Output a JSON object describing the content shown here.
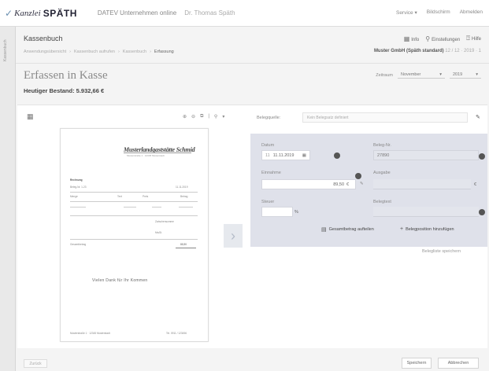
{
  "topbar": {
    "logo_k": "Kanzlei",
    "logo_s": "SPÄTH",
    "product": "DATEV Unternehmen online",
    "user": "Dr. Thomas Späth",
    "links": [
      "Service ▾",
      "Bildschirm",
      "Abmelden"
    ]
  },
  "leftstrip": {
    "tab": "Kassenbuch"
  },
  "page": {
    "title": "Kassenbuch",
    "breadcrumb": [
      "Anwendungsübersicht",
      "Kassenbuch aufrufen",
      "Kassenbuch",
      "Erfassung"
    ],
    "actions": {
      "info": "Info",
      "settings": "Einstellungen",
      "help": "Hilfe"
    },
    "company": "Muster GmbH (Späth standard)",
    "company_extra": "12 / 12 · 2019 · 1",
    "heading": "Erfassen in Kasse",
    "bestand": "Heutiger Bestand: 5.932,66 €",
    "zeitraum_label": "Zeitraum",
    "month": "November",
    "year": "2019"
  },
  "toolbar": {
    "belegquelle_label": "Belegquelle:",
    "belegquelle_placeholder": "Kein Belegsatz definiert"
  },
  "document": {
    "title": "Musterlandgaststätte Schmid",
    "subtitle": "Musterstraße 1 · 12345 Musterstadt",
    "rechnung": "Rechnung",
    "beleg_nr": "Beleg-Nr. 1-23",
    "datum": "11.11.2019",
    "col_menge": "Menge",
    "col_text": "Text",
    "col_preis": "Preis",
    "col_betrag": "Betrag",
    "zwischensumme": "Zwischensumme",
    "mwst": "MwSt.",
    "gesamt": "Gesamtbetrag",
    "betrag": "89,50",
    "thanks": "Vielen Dank für Ihr Kommen",
    "footer_left": "Musterstraße 1 · 12345 Musterstadt",
    "footer_right": "Tel. 0911 / 123456"
  },
  "form": {
    "datum_label": "Datum",
    "datum_value": "11.11.2019",
    "datum_prefix": "11",
    "einnahme_label": "Einnahme",
    "einnahme_value": "89,50",
    "einnahme_unit": "€",
    "steuer_label": "Steuer",
    "steuer_unit": "%",
    "belegnr_label": "Beleg-Nr.",
    "belegnr_value": "27890",
    "ausgabe_label": "Ausgabe",
    "ausgabe_unit": "€",
    "belegtext_label": "Belegtext",
    "action_split": "Gesamtbetrag aufteilen",
    "action_add": "Belegposition hinzufügen"
  },
  "belegliste": "Belegliste speichern",
  "buttons": {
    "zurueck": "Zurück",
    "speichern": "Speichern",
    "abbrechen": "Abbrechen"
  }
}
